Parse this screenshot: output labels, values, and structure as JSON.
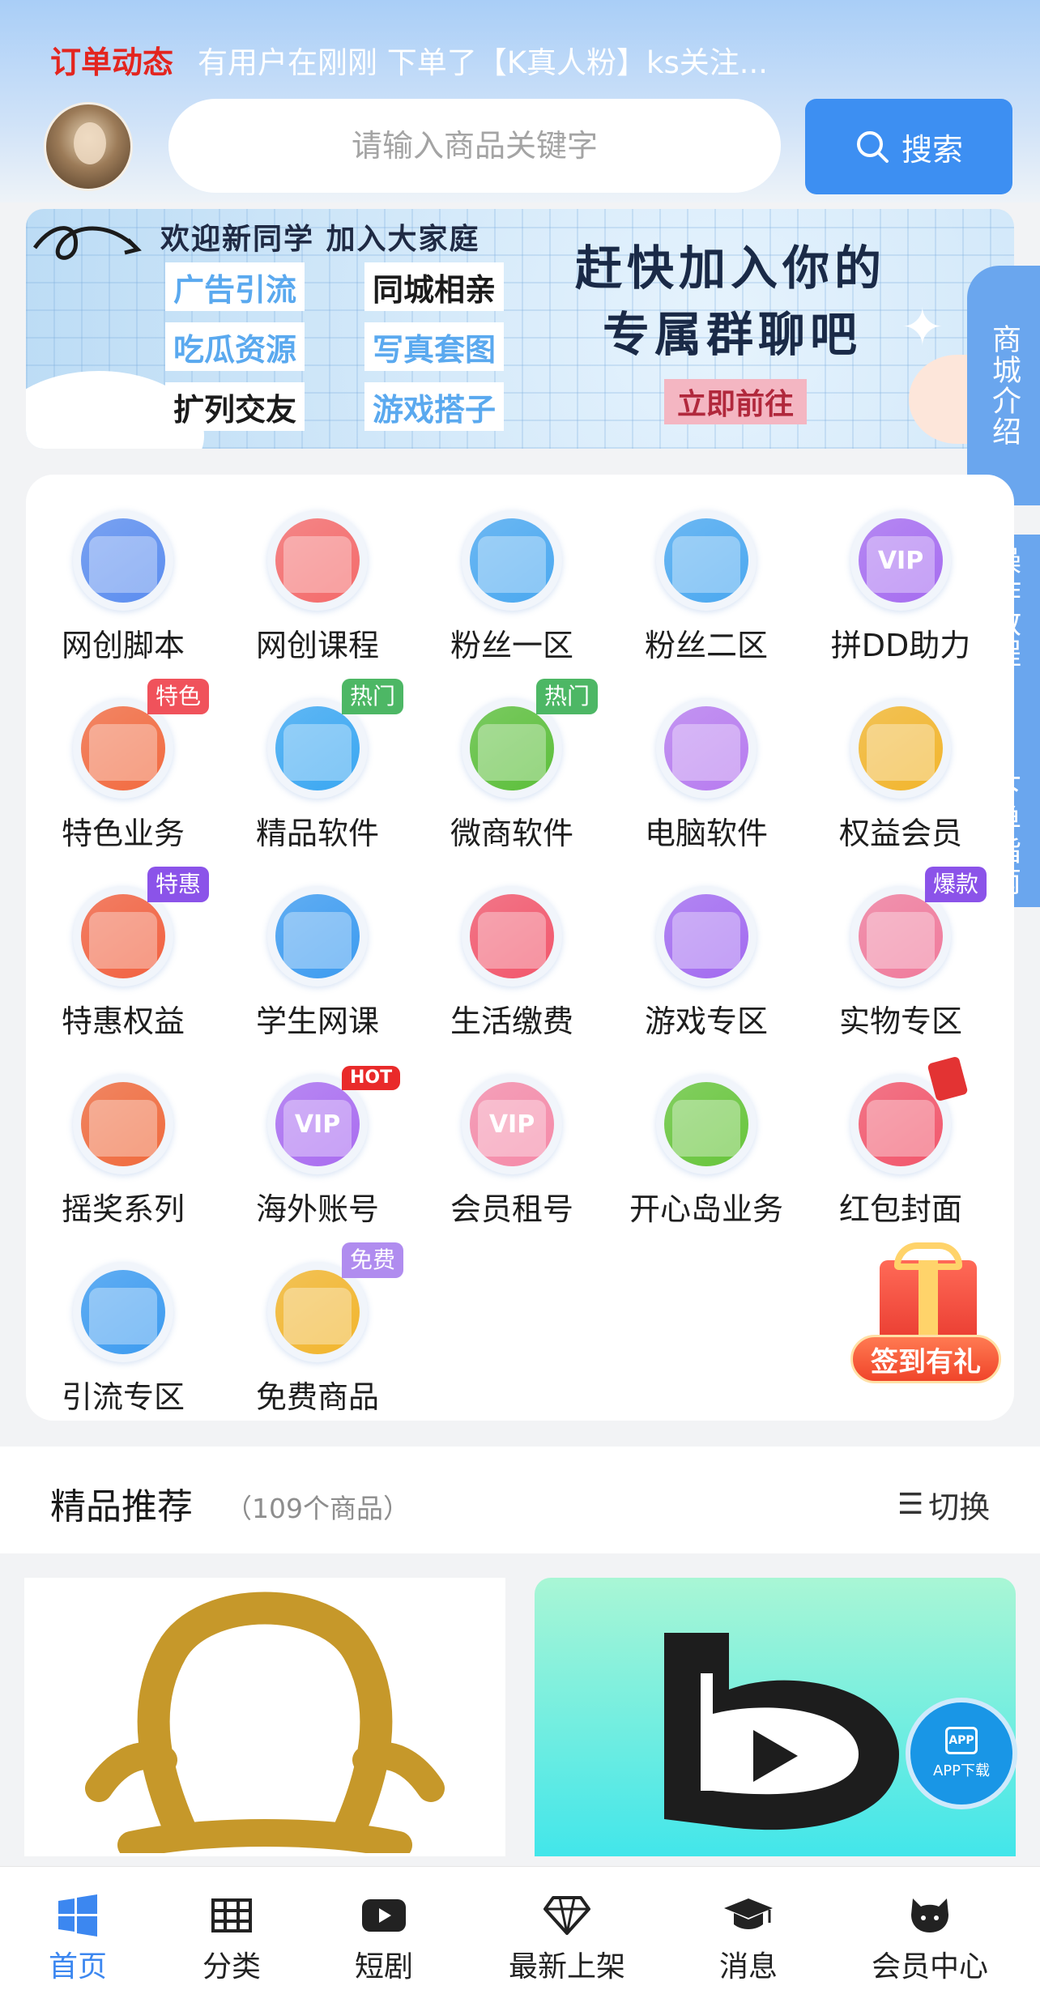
{
  "ticker": {
    "title": "订单动态",
    "text": "有用户在刚刚 下单了【K真人粉】ks关注..."
  },
  "search": {
    "placeholder": "请输入商品关键字",
    "button_label": "搜索"
  },
  "banner": {
    "welcome": "欢迎新同学 加入大家庭",
    "tags": [
      "广告引流",
      "同城相亲",
      "吃瓜资源",
      "写真套图",
      "扩列交友",
      "游戏搭子"
    ],
    "headline_1": "赶快加入你的",
    "headline_2": "专属群聊吧",
    "cta": "立即前往"
  },
  "side_tabs": {
    "mall_intro": "商城介绍",
    "tutorial": "操作教程 - 下单指南"
  },
  "categories": [
    {
      "label": "网创脚本",
      "icon": "flame-icon",
      "color": "#5b8def",
      "badge": ""
    },
    {
      "label": "网创课程",
      "icon": "flame-icon",
      "color": "#f46a6a",
      "badge": ""
    },
    {
      "label": "粉丝一区",
      "icon": "people-icon",
      "color": "#4aa8f0",
      "badge": ""
    },
    {
      "label": "粉丝二区",
      "icon": "people-icon",
      "color": "#4aa8f0",
      "badge": ""
    },
    {
      "label": "拼DD助力",
      "icon": "vip-star-icon",
      "color": "#a66cf0",
      "badge": ""
    },
    {
      "label": "特色业务",
      "icon": "alarm-clock-icon",
      "color": "#f26a3f",
      "badge": "特色"
    },
    {
      "label": "精品软件",
      "icon": "u-bag-icon",
      "color": "#3aa7f2",
      "badge": "热门"
    },
    {
      "label": "微商软件",
      "icon": "u-bag-icon",
      "color": "#5cbf3a",
      "badge": "热门"
    },
    {
      "label": "电脑软件",
      "icon": "u-bag-icon",
      "color": "#b77bef",
      "badge": ""
    },
    {
      "label": "权益会员",
      "icon": "coins-icon",
      "color": "#f2b52c",
      "badge": ""
    },
    {
      "label": "特惠权益",
      "icon": "discount-icon",
      "color": "#f2613f",
      "badge": "特惠"
    },
    {
      "label": "学生网课",
      "icon": "graduation-cap-icon",
      "color": "#3c9bf0",
      "badge": ""
    },
    {
      "label": "生活缴费",
      "icon": "wallet-icon",
      "color": "#f2566b",
      "badge": ""
    },
    {
      "label": "游戏专区",
      "icon": "gamepad-icon",
      "color": "#a26af0",
      "badge": ""
    },
    {
      "label": "实物专区",
      "icon": "gift-box-icon",
      "color": "#f07a9b",
      "badge": "爆款"
    },
    {
      "label": "摇奖系列",
      "icon": "lottery-icon",
      "color": "#f06a3c",
      "badge": ""
    },
    {
      "label": "海外账号",
      "icon": "vip-star-icon",
      "color": "#a96cf0",
      "badge": "HOT"
    },
    {
      "label": "会员租号",
      "icon": "vip-star-icon",
      "color": "#f58aa8",
      "badge": ""
    },
    {
      "label": "开心岛业务",
      "icon": "island-icon",
      "color": "#67c53a",
      "badge": ""
    },
    {
      "label": "红包封面",
      "icon": "red-envelope-icon",
      "color": "#f2566b",
      "badge": "envelope"
    },
    {
      "label": "引流专区",
      "icon": "grid-apps-icon",
      "color": "#3c9bf0",
      "badge": ""
    },
    {
      "label": "免费商品",
      "icon": "gift-box-icon",
      "color": "#f2b52c",
      "badge": "免费"
    }
  ],
  "badge_colors": {
    "特色": "red",
    "热门": "green",
    "特惠": "purple",
    "爆款": "purple",
    "免费": "lavender",
    "HOT": "hot",
    "envelope": "env"
  },
  "sign_in": {
    "label": "签到有礼"
  },
  "recommend": {
    "title": "精品推荐",
    "count": "（109个商品）",
    "switch_label": "切换"
  },
  "app_download": {
    "icon_text": "APP",
    "label": "APP下载"
  },
  "bottom_nav": [
    {
      "label": "首页",
      "icon": "windows-home-icon",
      "active": true
    },
    {
      "label": "分类",
      "icon": "grid-icon",
      "active": false
    },
    {
      "label": "短剧",
      "icon": "play-icon",
      "active": false
    },
    {
      "label": "最新上架",
      "icon": "diamond-icon",
      "active": false
    },
    {
      "label": "消息",
      "icon": "graduation-cap-icon",
      "active": false
    },
    {
      "label": "会员中心",
      "icon": "cat-icon",
      "active": false
    }
  ],
  "colors": {
    "accent": "#3d8ff2",
    "ticker_title": "#e3251f",
    "nav_active": "#3c87f0"
  }
}
